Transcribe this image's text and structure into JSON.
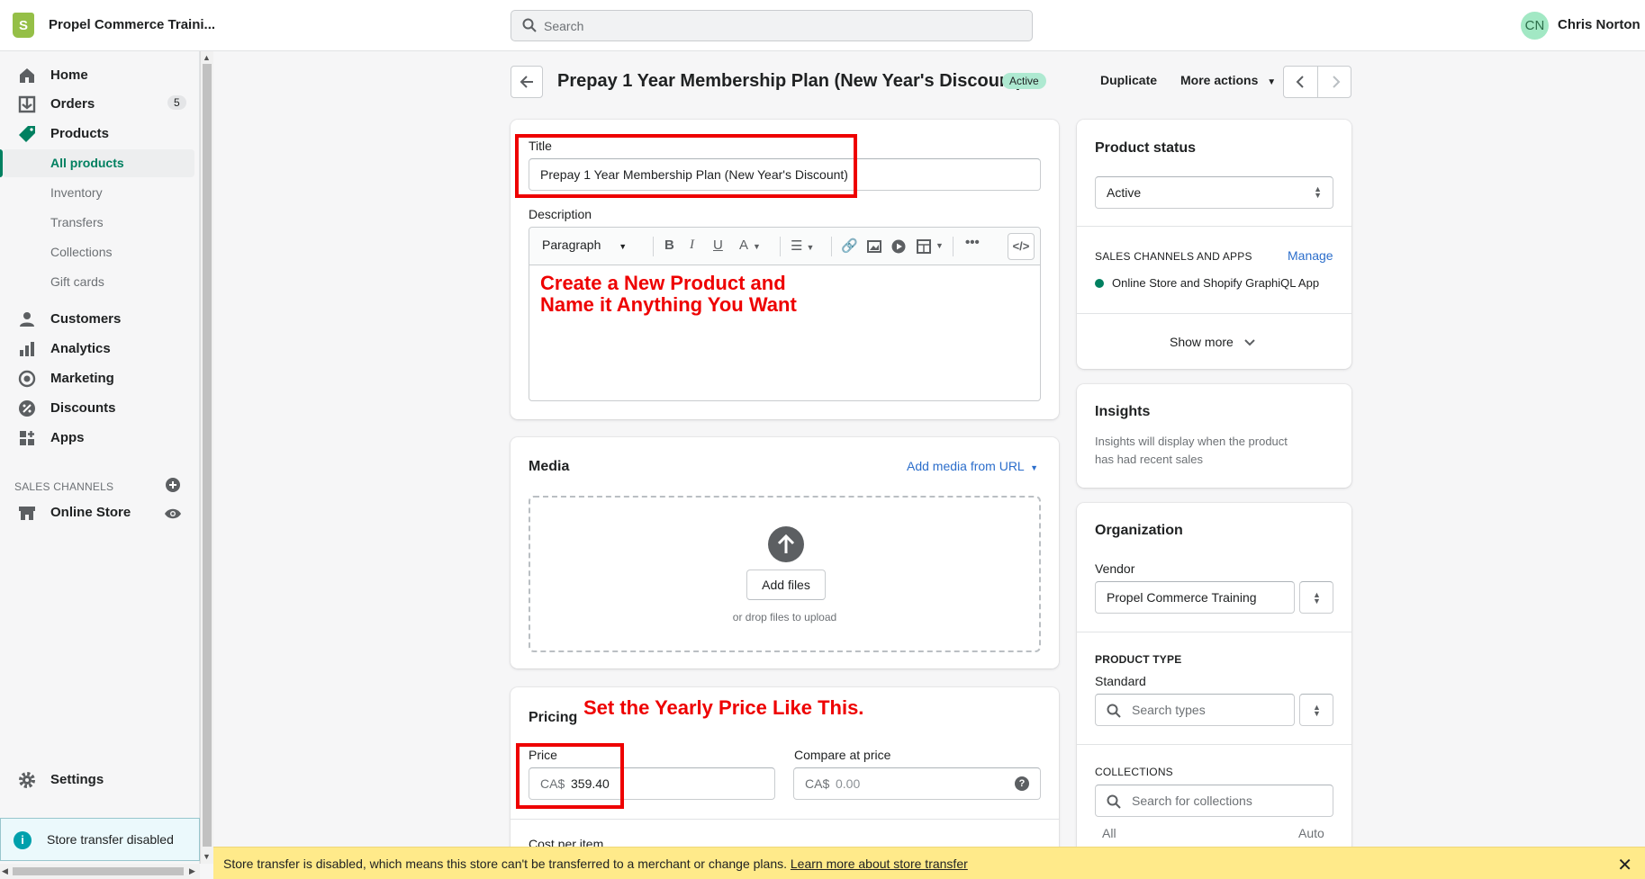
{
  "topbar": {
    "store_name": "Propel Commerce Traini...",
    "search_placeholder": "Search",
    "avatar_initials": "CN",
    "user_name": "Chris Norton"
  },
  "sidebar": {
    "home": "Home",
    "orders": "Orders",
    "orders_badge": "5",
    "products": "Products",
    "all_products": "All products",
    "inventory": "Inventory",
    "transfers": "Transfers",
    "collections": "Collections",
    "gift_cards": "Gift cards",
    "customers": "Customers",
    "analytics": "Analytics",
    "marketing": "Marketing",
    "discounts": "Discounts",
    "apps": "Apps",
    "sales_channels_label": "SALES CHANNELS",
    "online_store": "Online Store",
    "settings": "Settings",
    "store_transfer": "Store transfer disabled"
  },
  "header": {
    "title": "Prepay 1 Year Membership Plan (New Year's Discount)",
    "status": "Active",
    "duplicate": "Duplicate",
    "more_actions": "More actions"
  },
  "main": {
    "title_label": "Title",
    "title_value": "Prepay 1 Year Membership Plan (New Year's Discount)",
    "description_label": "Description",
    "paragraph": "Paragraph",
    "annotation_1_line1": "Create a New Product and",
    "annotation_1_line2": "Name it Anything You Want",
    "media_title": "Media",
    "add_media_url": "Add media from URL",
    "add_files": "Add files",
    "drop_hint": "or drop files to upload",
    "pricing_title": "Pricing",
    "annotation_2": "Set the Yearly Price Like This.",
    "price_label": "Price",
    "price_prefix": "CA$",
    "price_value": "359.40",
    "compare_label": "Compare at price",
    "compare_prefix": "CA$",
    "compare_placeholder": "0.00",
    "cost_label": "Cost per item"
  },
  "right": {
    "product_status_title": "Product status",
    "status_value": "Active",
    "sales_channels_label": "SALES CHANNELS AND APPS",
    "manage": "Manage",
    "channel": "Online Store and Shopify GraphiQL App",
    "show_more": "Show more",
    "insights_title": "Insights",
    "insights_text_1": "Insights will display when the product",
    "insights_text_2": "has had recent sales",
    "organization_title": "Organization",
    "vendor_label": "Vendor",
    "vendor_value": "Propel Commerce Training",
    "product_type_label": "PRODUCT TYPE",
    "product_type_value": "Standard",
    "search_types": "Search types",
    "collections_label": "COLLECTIONS",
    "search_collections": "Search for collections",
    "all": "All",
    "auto": "Auto"
  },
  "banner": {
    "text": "Store transfer is disabled, which means this store can't be transferred to a merchant or change plans.",
    "link": "Learn more about store transfer"
  },
  "colors": {
    "accent_green": "#008060",
    "annotation_red": "#ee0000",
    "banner_yellow": "#ffea8a"
  }
}
